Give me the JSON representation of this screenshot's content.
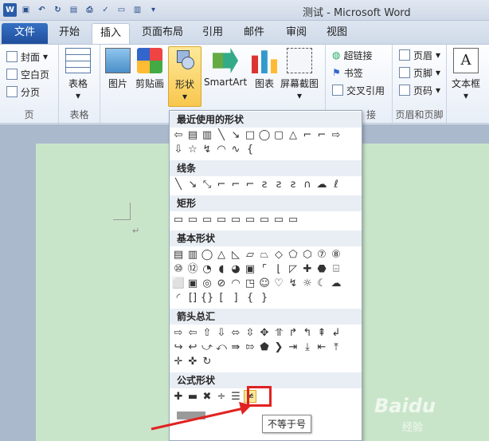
{
  "window": {
    "title": "测试 - Microsoft Word"
  },
  "qat": {
    "logo": "W",
    "icons": [
      "save-icon",
      "undo-icon",
      "redo-icon",
      "print-preview-icon",
      "print-icon",
      "spelling-icon",
      "open-icon",
      "quick-print-icon"
    ]
  },
  "tabs": [
    "文件",
    "开始",
    "插入",
    "页面布局",
    "引用",
    "邮件",
    "审阅",
    "视图"
  ],
  "ribbon": {
    "pages": {
      "items": [
        "封面",
        "空白页",
        "分页"
      ],
      "label": "页"
    },
    "tables": {
      "button": "表格",
      "label": "表格"
    },
    "illustrations": {
      "buttons": [
        "图片",
        "剪贴画",
        "形状",
        "SmartArt",
        "图表",
        "屏幕截图"
      ]
    },
    "links": {
      "items": [
        "超链接",
        "书签",
        "交叉引用"
      ],
      "label": "接"
    },
    "header_footer": {
      "items": [
        "页眉",
        "页脚",
        "页码"
      ],
      "label": "页眉和页脚"
    },
    "text": {
      "button": "文本框"
    }
  },
  "shapes_menu": {
    "sections": [
      "最近使用的形状",
      "线条",
      "矩形",
      "基本形状",
      "箭头总汇",
      "公式形状"
    ],
    "tooltip": "不等于号"
  },
  "watermark": {
    "brand": "Baidu",
    "sub": "经验"
  }
}
